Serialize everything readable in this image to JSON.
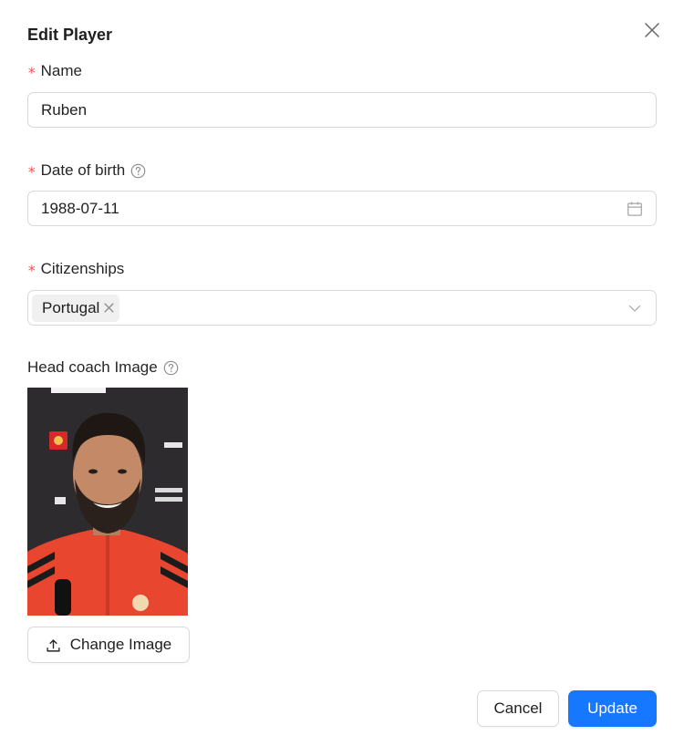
{
  "dialog": {
    "title": "Edit Player",
    "close_icon": "close-icon"
  },
  "form": {
    "name": {
      "label": "Name",
      "required_mark": "*",
      "value": "Ruben"
    },
    "date_of_birth": {
      "label": "Date of birth",
      "required_mark": "*",
      "value": "1988-07-11",
      "help_icon": "question-circle-icon",
      "suffix_icon": "calendar-icon"
    },
    "citizenships": {
      "label": "Citizenships",
      "required_mark": "*",
      "tags": [
        "Portugal"
      ],
      "suffix_icon": "chevron-down-icon"
    },
    "head_coach_image": {
      "label": "Head coach Image",
      "help_icon": "question-circle-icon",
      "upload_label": "Change Image",
      "upload_icon": "upload-icon"
    }
  },
  "footer": {
    "cancel_label": "Cancel",
    "update_label": "Update"
  },
  "colors": {
    "primary": "#1677ff",
    "required": "#ff4d4f",
    "border": "#d9d9d9",
    "tag_bg": "#f0f0f0"
  }
}
